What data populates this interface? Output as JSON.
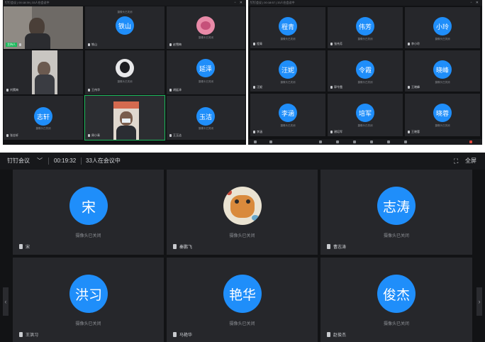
{
  "top_left": {
    "window_title": "钉钉会议 | 00:18:39 | 33人在会议中",
    "camera_off": "摄像头已关闭",
    "tiles": [
      {
        "name": "",
        "avatar": "",
        "type": "video",
        "tag": "主持人"
      },
      {
        "name": "铁山",
        "avatar": "铁山",
        "type": "avatar"
      },
      {
        "name": "赵雪梅",
        "avatar": "",
        "type": "image"
      },
      {
        "name": "刘素梅",
        "avatar": "",
        "type": "video"
      },
      {
        "name": "王伟华",
        "avatar": "",
        "type": "image"
      },
      {
        "name": "胡延泽",
        "avatar": "延泽",
        "type": "avatar"
      },
      {
        "name": "张志轩",
        "avatar": "志轩",
        "type": "avatar"
      },
      {
        "name": "周小青",
        "avatar": "",
        "type": "video"
      },
      {
        "name": "王玉洁",
        "avatar": "玉洁",
        "type": "avatar"
      }
    ]
  },
  "top_right": {
    "window_title": "钉钉会议 | 00:18:57 | 33人在会议中",
    "camera_off": "摄像头已关闭",
    "tiles": [
      {
        "name": "程青",
        "avatar": "程青"
      },
      {
        "name": "张伟芳",
        "avatar": "伟芳"
      },
      {
        "name": "李小玲",
        "avatar": "小玲"
      },
      {
        "name": "汪妮",
        "avatar": "汪妮"
      },
      {
        "name": "郭令霞",
        "avatar": "令霞"
      },
      {
        "name": "王晓峰",
        "avatar": "晓峰"
      },
      {
        "name": "李涵",
        "avatar": "李涵"
      },
      {
        "name": "谢培军",
        "avatar": "培军"
      },
      {
        "name": "王晓蓉",
        "avatar": "晓蓉"
      }
    ]
  },
  "meeting": {
    "app_name": "钉钉会议",
    "timer": "00:19:32",
    "participants": "33人在会议中",
    "fullscreen": "全屏",
    "camera_off": "摄像头已关闭",
    "tiles": [
      {
        "name": "宋",
        "avatar": "宋",
        "type": "avatar"
      },
      {
        "name": "秦鹏飞",
        "avatar": "",
        "type": "image"
      },
      {
        "name": "曹志涛",
        "avatar": "志涛",
        "type": "avatar"
      },
      {
        "name": "王洪习",
        "avatar": "洪习",
        "type": "avatar"
      },
      {
        "name": "马艳华",
        "avatar": "艳华",
        "type": "avatar"
      },
      {
        "name": "赵俊杰",
        "avatar": "俊杰",
        "type": "avatar"
      }
    ]
  },
  "colors": {
    "avatar_blue": "#1f8efa",
    "active_border": "#1bb95b",
    "tile_bg": "#26272b"
  }
}
